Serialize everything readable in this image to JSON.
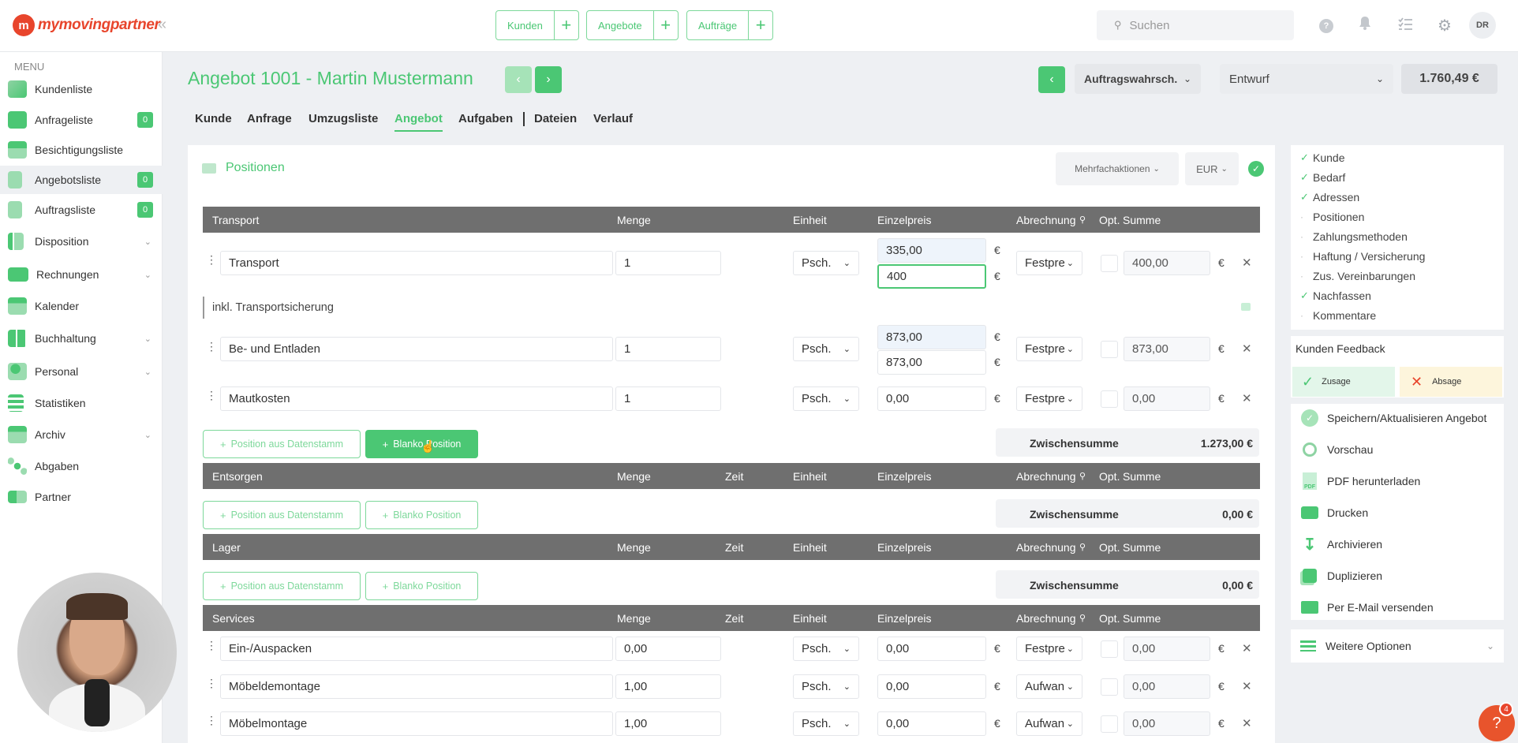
{
  "brand": {
    "logo_text": "mymovingpartner",
    "accent": "#4bc774",
    "logo_color": "#e8452c"
  },
  "topbar": {
    "buttons": [
      {
        "label": "Kunden"
      },
      {
        "label": "Angebote"
      },
      {
        "label": "Aufträge"
      }
    ],
    "search_placeholder": "Suchen",
    "avatar": "DR"
  },
  "sidebar": {
    "menu_heading": "MENU",
    "items": [
      {
        "label": "Kundenliste",
        "badge": null
      },
      {
        "label": "Anfrageliste",
        "badge": "0"
      },
      {
        "label": "Besichtigungsliste",
        "badge": null
      },
      {
        "label": "Angebotsliste",
        "badge": "0"
      },
      {
        "label": "Auftragsliste",
        "badge": "0"
      },
      {
        "label": "Disposition",
        "badge": null
      },
      {
        "label": "Rechnungen",
        "badge": null
      },
      {
        "label": "Kalender",
        "badge": null
      },
      {
        "label": "Buchhaltung",
        "badge": null
      },
      {
        "label": "Personal",
        "badge": null
      },
      {
        "label": "Statistiken",
        "badge": null
      },
      {
        "label": "Archiv",
        "badge": null
      },
      {
        "label": "Abgaben",
        "badge": null
      },
      {
        "label": "Partner",
        "badge": null
      }
    ]
  },
  "header": {
    "title": "Angebot 1001 - Martin Mustermann",
    "probability_label": "Auftragswahrsch.",
    "status": "Entwurf",
    "total": "1.760,49 €"
  },
  "tabs": [
    "Kunde",
    "Anfrage",
    "Umzugsliste",
    "Angebot",
    "Aufgaben",
    "Dateien",
    "Verlauf"
  ],
  "positions": {
    "title": "Positionen",
    "bulk_actions": "Mehrfachaktionen",
    "currency": "EUR",
    "currency_symbol": "€",
    "columns": {
      "menge": "Menge",
      "zeit": "Zeit",
      "einheit": "Einheit",
      "einzelpreis": "Einzelpreis",
      "abrechnung": "Abrechnung",
      "opt": "Opt.",
      "summe": "Summe"
    },
    "btn_datenstamm": "Position aus Datenstamm",
    "btn_blanko": "Blanko Position",
    "subtotal_label": "Zwischensumme",
    "sections": [
      {
        "name": "Transport",
        "subtotal": "1.273,00 €",
        "rows": [
          {
            "name": "Transport",
            "qty": "1",
            "unit": "Psch.",
            "price_top": "335,00",
            "price": "400",
            "billing": "Festpre",
            "sum": "400,00",
            "note": "inkl. Transportsicherung"
          },
          {
            "name": "Be- und Entladen",
            "qty": "1",
            "unit": "Psch.",
            "price_top": "873,00",
            "price": "873,00",
            "billing": "Festpre",
            "sum": "873,00"
          },
          {
            "name": "Mautkosten",
            "qty": "1",
            "unit": "Psch.",
            "price": "0,00",
            "billing": "Festpre",
            "sum": "0,00"
          }
        ]
      },
      {
        "name": "Entsorgen",
        "subtotal": "0,00 €",
        "rows": []
      },
      {
        "name": "Lager",
        "subtotal": "0,00 €",
        "rows": []
      },
      {
        "name": "Services",
        "rows": [
          {
            "name": "Ein-/Auspacken",
            "qty": "0,00",
            "unit": "Psch.",
            "price": "0,00",
            "billing": "Festpre",
            "sum": "0,00"
          },
          {
            "name": "Möbeldemontage",
            "qty": "1,00",
            "unit": "Psch.",
            "price": "0,00",
            "billing": "Aufwan",
            "sum": "0,00"
          },
          {
            "name": "Möbelmontage",
            "qty": "1,00",
            "unit": "Psch.",
            "price": "0,00",
            "billing": "Aufwan",
            "sum": "0,00"
          }
        ]
      }
    ]
  },
  "checklist": [
    {
      "label": "Kunde",
      "done": true
    },
    {
      "label": "Bedarf",
      "done": true
    },
    {
      "label": "Adressen",
      "done": true
    },
    {
      "label": "Positionen",
      "done": false
    },
    {
      "label": "Zahlungsmethoden",
      "done": false
    },
    {
      "label": "Haftung / Versicherung",
      "done": false
    },
    {
      "label": "Zus. Vereinbarungen",
      "done": false
    },
    {
      "label": "Nachfassen",
      "done": true
    },
    {
      "label": "Kommentare",
      "done": false
    }
  ],
  "feedback": {
    "title": "Kunden Feedback",
    "accept": "Zusage",
    "reject": "Absage"
  },
  "actions": [
    {
      "label": "Speichern/Aktualisieren Angebot",
      "icon": "save-check-icon"
    },
    {
      "label": "Vorschau",
      "icon": "magnifier-icon"
    },
    {
      "label": "PDF herunterladen",
      "icon": "pdf-icon"
    },
    {
      "label": "Drucken",
      "icon": "printer-icon"
    },
    {
      "label": "Archivieren",
      "icon": "archive-download-icon"
    },
    {
      "label": "Duplizieren",
      "icon": "duplicate-icon"
    },
    {
      "label": "Per E-Mail versenden",
      "icon": "email-icon"
    }
  ],
  "more_options": "Weitere Optionen",
  "help": {
    "symbol": "?",
    "badge": "4"
  }
}
